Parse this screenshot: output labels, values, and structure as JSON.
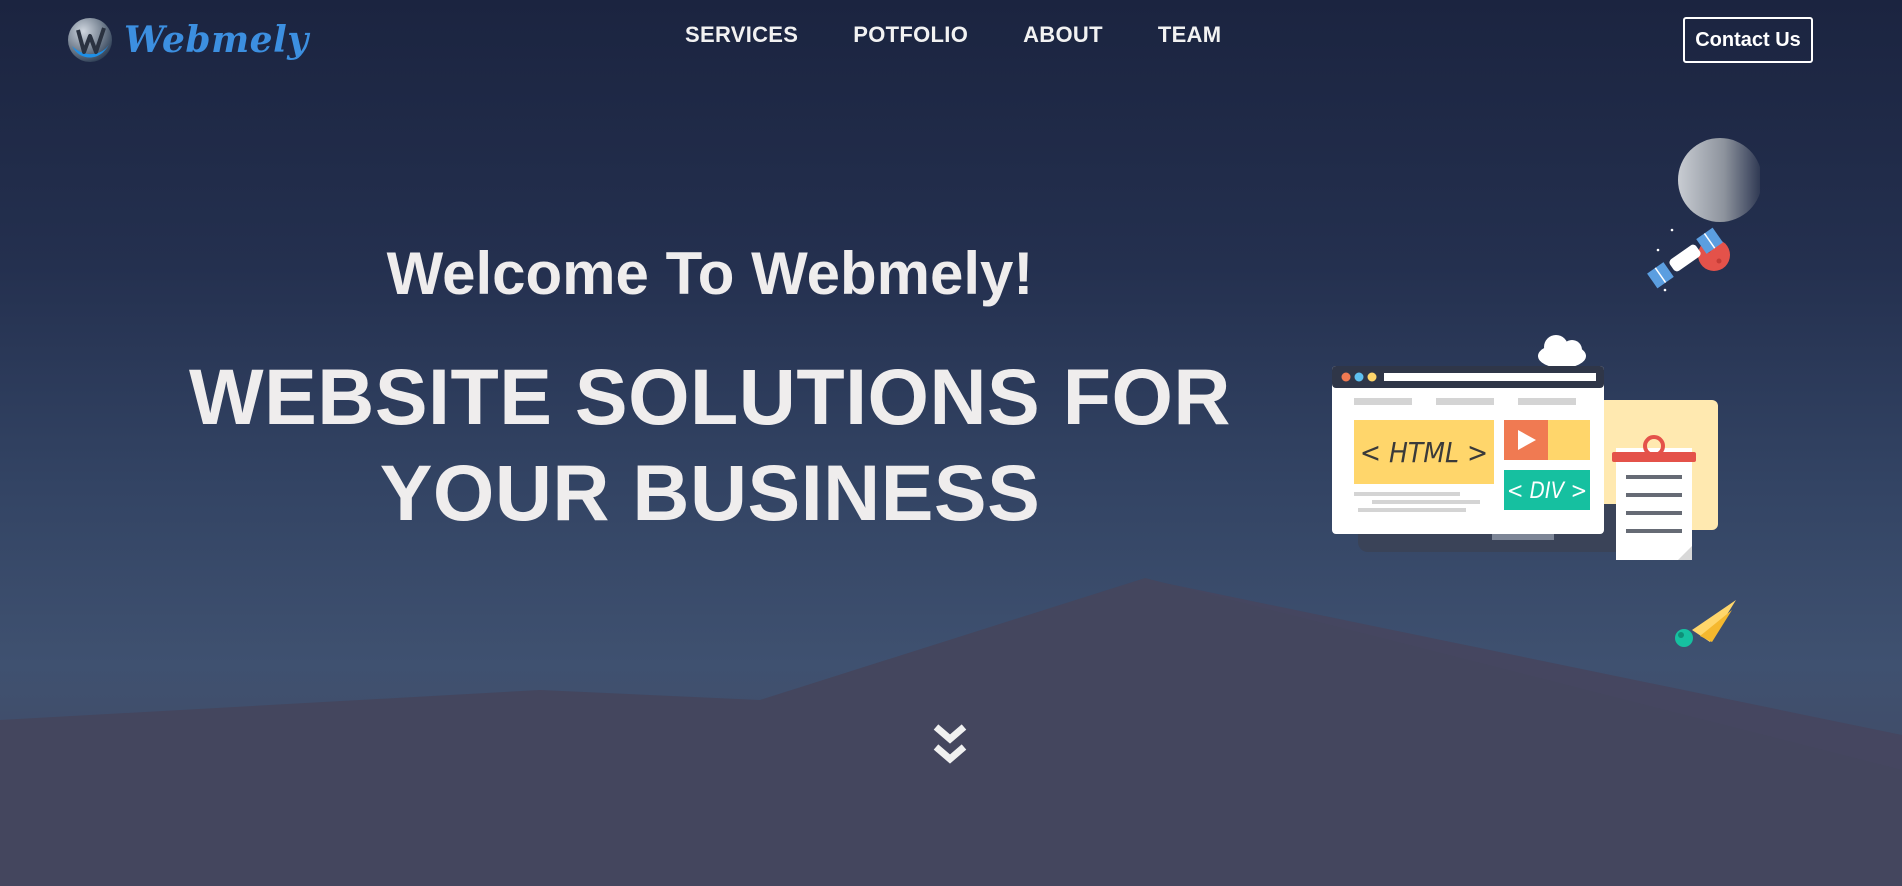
{
  "brand": {
    "name": "Webmely",
    "logo_icon": "w-logo-icon",
    "color": "#3c8fe0"
  },
  "nav": {
    "items": [
      {
        "label": "SERVICES"
      },
      {
        "label": "POTFOLIO"
      },
      {
        "label": "ABOUT"
      },
      {
        "label": "TEAM"
      }
    ]
  },
  "header": {
    "contact_label": "Contact Us"
  },
  "hero": {
    "welcome": "Welcome To Webmely!",
    "headline_line1": "WEBSITE SOLUTIONS FOR",
    "headline_line2": "YOUR BUSINESS",
    "scroll_icon": "double-chevron-down-icon"
  },
  "illustration": {
    "html_tag": "< HTML >",
    "div_tag": "< DIV >",
    "icons": [
      "moon-icon",
      "satellite-icon",
      "cloud-icon",
      "browser-window-icon",
      "notepad-icon",
      "comet-icon"
    ]
  },
  "colors": {
    "background_top": "#1b2440",
    "background_bottom": "#44465e",
    "text": "#efeded",
    "brand": "#3c8fe0",
    "yellow": "#ffd66b",
    "green": "#16c0a0",
    "orange": "#f07a52",
    "red": "#e4524a"
  }
}
